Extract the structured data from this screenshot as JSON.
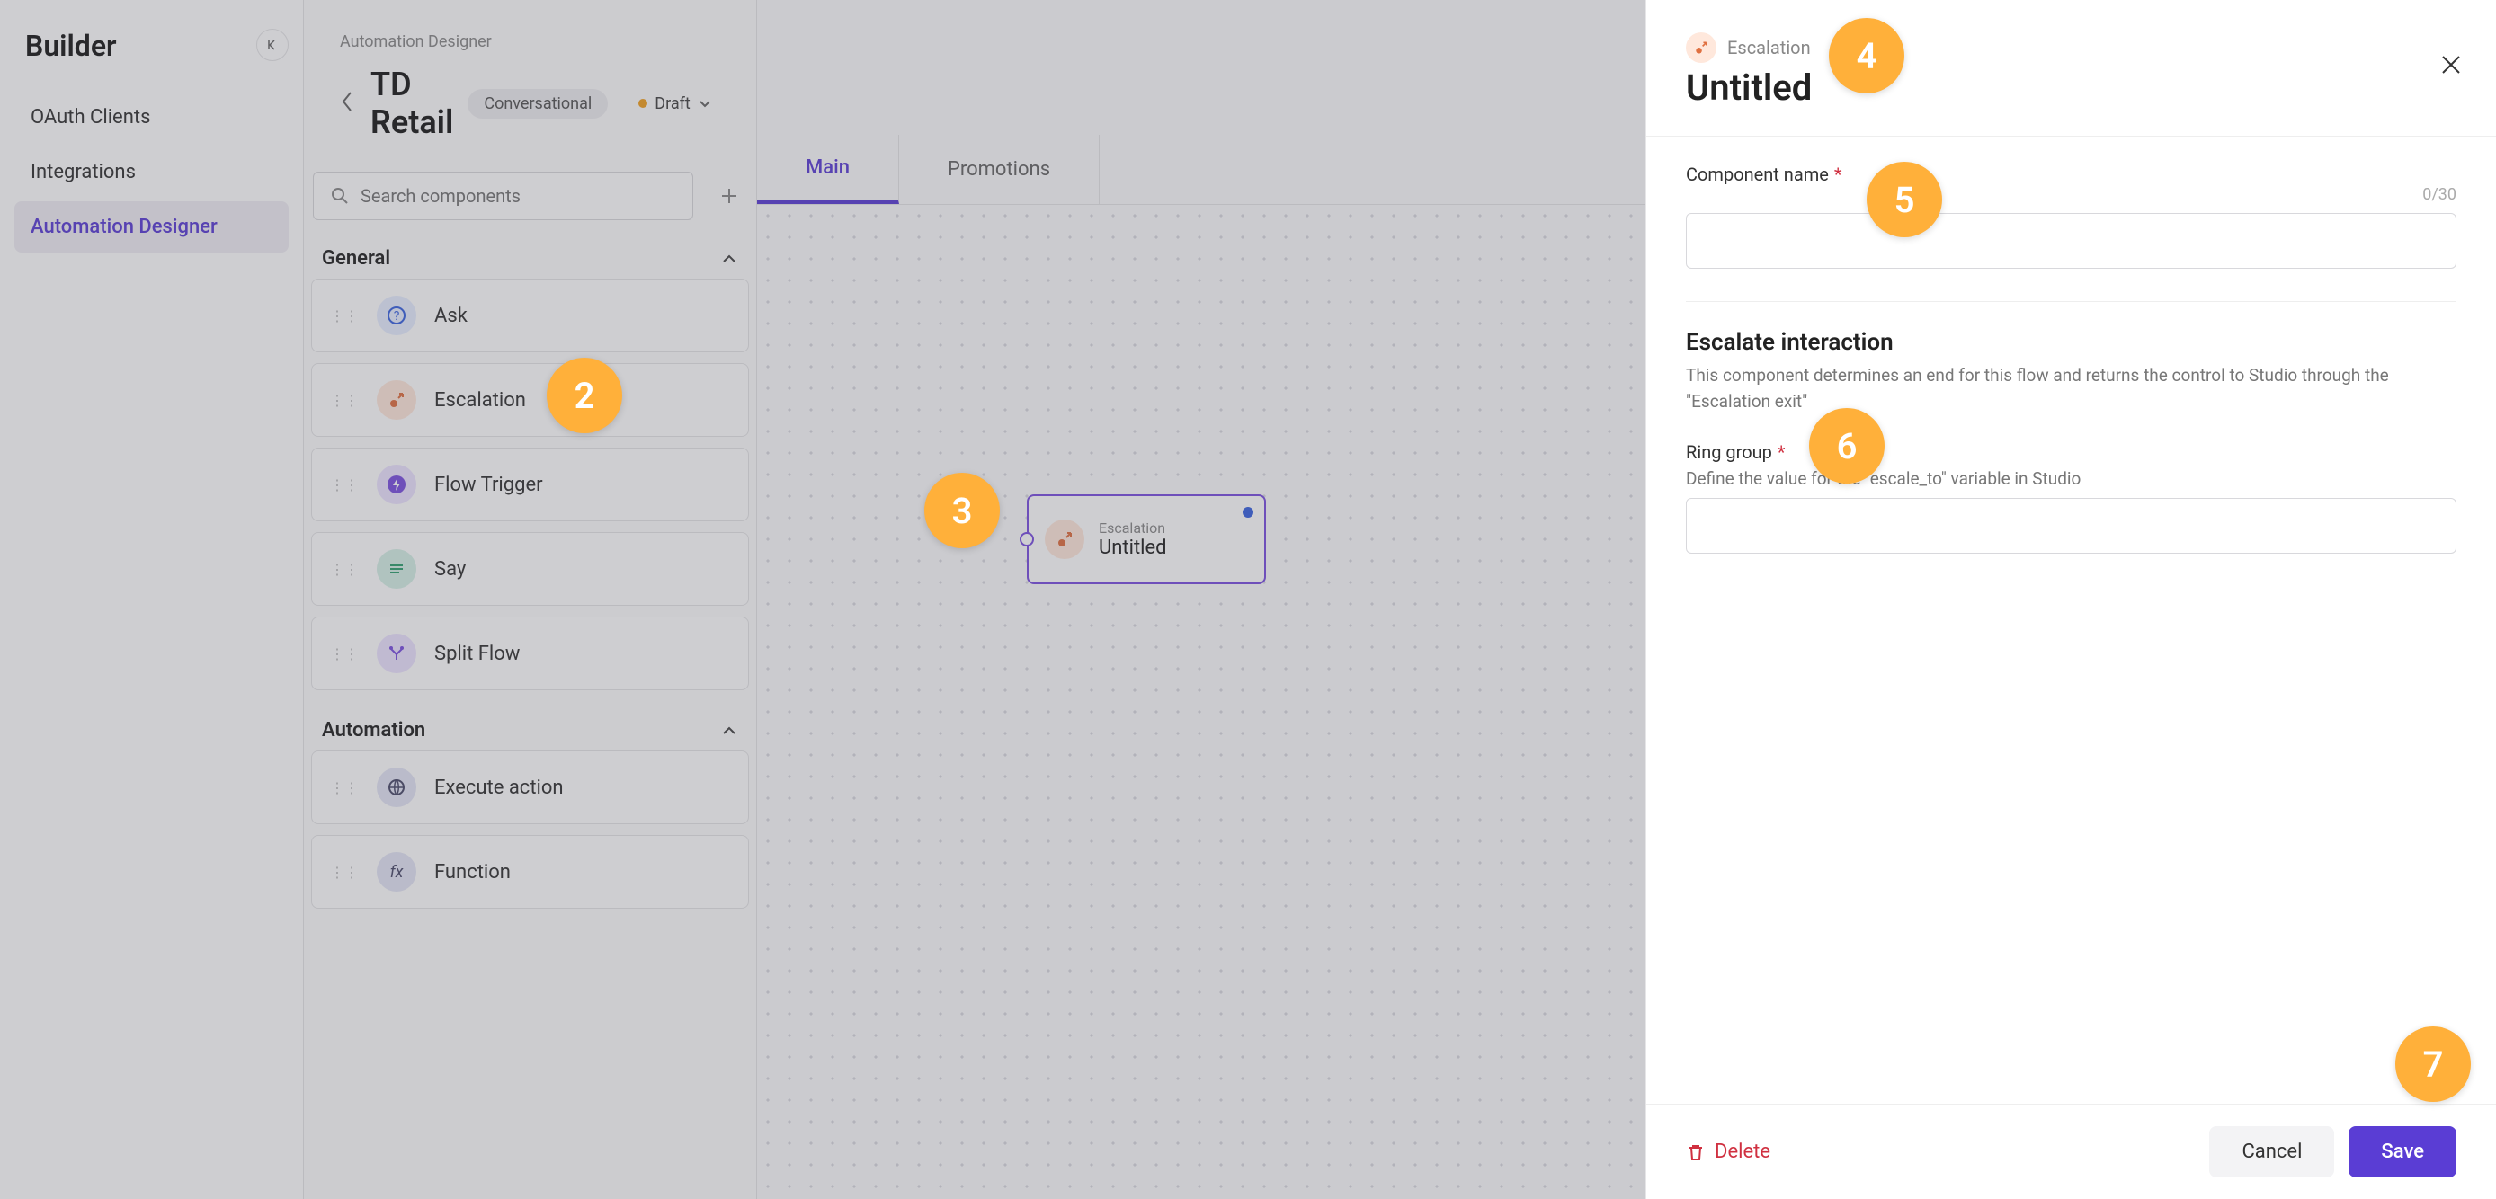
{
  "sidebar": {
    "title": "Builder",
    "items": [
      {
        "label": "OAuth Clients",
        "active": false
      },
      {
        "label": "Integrations",
        "active": false
      },
      {
        "label": "Automation Designer",
        "active": true
      }
    ]
  },
  "components_panel": {
    "breadcrumb": "Automation Designer",
    "title": "TD Retail",
    "badge_conversational": "Conversational",
    "status_label": "Draft",
    "search_placeholder": "Search components",
    "sections": {
      "general": {
        "label": "General",
        "items": [
          {
            "label": "Ask",
            "icon": "question-circle-icon",
            "color": "blue"
          },
          {
            "label": "Escalation",
            "icon": "escalation-icon",
            "color": "orange"
          },
          {
            "label": "Flow Trigger",
            "icon": "bolt-icon",
            "color": "purple"
          },
          {
            "label": "Say",
            "icon": "lines-icon",
            "color": "teal"
          },
          {
            "label": "Split Flow",
            "icon": "split-icon",
            "color": "purple"
          }
        ]
      },
      "automation": {
        "label": "Automation",
        "items": [
          {
            "label": "Execute action",
            "icon": "globe-icon",
            "color": "dark"
          },
          {
            "label": "Function",
            "icon": "fx-icon",
            "color": "dark"
          }
        ]
      }
    }
  },
  "canvas": {
    "tabs": [
      {
        "label": "Main",
        "active": true
      },
      {
        "label": "Promotions",
        "active": false
      }
    ],
    "node": {
      "type_label": "Escalation",
      "title": "Untitled"
    }
  },
  "config": {
    "type_label": "Escalation",
    "title": "Untitled",
    "component_name": {
      "label": "Component name",
      "char_count": "0/30",
      "value": ""
    },
    "escalate_block": {
      "title": "Escalate interaction",
      "description": "This component determines an end for this flow and returns the control to Studio through the \"Escalation exit\""
    },
    "ring_group": {
      "label": "Ring group",
      "sublabel": "Define the value for the \"escale_to\" variable in Studio",
      "value": ""
    },
    "footer": {
      "delete": "Delete",
      "cancel": "Cancel",
      "save": "Save"
    }
  },
  "tutorial_badges": {
    "b2": "2",
    "b3": "3",
    "b4": "4",
    "b5": "5",
    "b6": "6",
    "b7": "7"
  }
}
